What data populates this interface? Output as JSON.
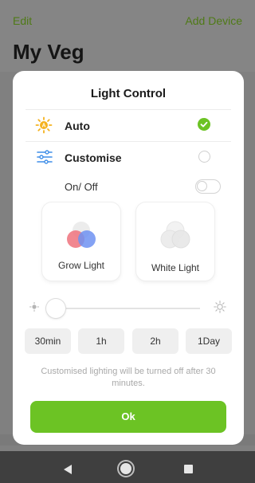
{
  "background": {
    "edit_label": "Edit",
    "add_device_label": "Add Device",
    "title": "My Veg"
  },
  "dialog": {
    "title": "Light Control",
    "auto": {
      "label": "Auto",
      "icon": "sun-icon",
      "selected": true
    },
    "customise": {
      "label": "Customise",
      "icon": "sliders-icon",
      "selected": false
    },
    "on_off": {
      "label": "On/ Off",
      "enabled": false
    },
    "light_modes": [
      {
        "label": "Grow Light",
        "icon": "grow-light-icon"
      },
      {
        "label": "White Light",
        "icon": "white-light-icon"
      }
    ],
    "brightness": {
      "level": 0
    },
    "durations": [
      "30min",
      "1h",
      "2h",
      "1Day"
    ],
    "note": "Customised lighting will be turned off after 30 minutes.",
    "ok_label": "Ok"
  },
  "colors": {
    "accent": "#6cc324",
    "overlay": "#808080",
    "dialog_bg": "#ffffff",
    "icon_blue": "#3f8ee8",
    "icon_yellow": "#f5b21e"
  }
}
